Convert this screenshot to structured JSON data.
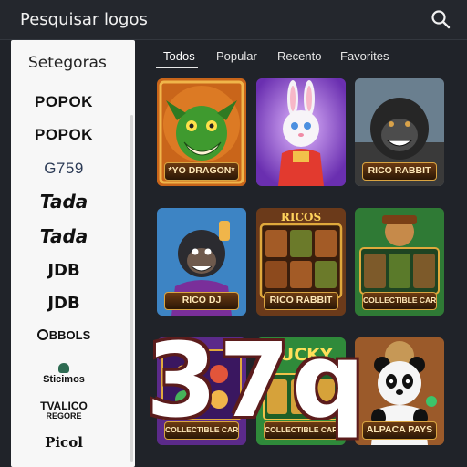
{
  "header": {
    "title": "Pesquisar logos",
    "search_icon": "search-icon"
  },
  "sidebar": {
    "heading": "Setegoras",
    "brands": [
      {
        "label": "POPOK",
        "sub": ""
      },
      {
        "label": "POPOK",
        "sub": ""
      },
      {
        "label": "G759",
        "sub": ""
      },
      {
        "label": "Tada",
        "sub": ""
      },
      {
        "label": "Tada",
        "sub": ""
      },
      {
        "label": "JDB",
        "sub": ""
      },
      {
        "label": "JDB",
        "sub": ""
      },
      {
        "label": "BBOLS",
        "sub": ""
      },
      {
        "label": "Sticimos",
        "sub": ""
      },
      {
        "label": "TVALICO",
        "sub": "REGORE"
      },
      {
        "label": "Picol",
        "sub": ""
      }
    ]
  },
  "tabs": [
    {
      "label": "Todos",
      "active": true
    },
    {
      "label": "Popular",
      "active": false
    },
    {
      "label": "Recento",
      "active": false
    },
    {
      "label": "Favorites",
      "active": false
    }
  ],
  "games": [
    {
      "title": "*YO DRAGON*",
      "art": "dragon"
    },
    {
      "title": "",
      "art": "rabbit"
    },
    {
      "title": "RICO RABBIT",
      "art": "gorilla"
    },
    {
      "title": "RICO DJ",
      "art": "monkey-dj"
    },
    {
      "title": "RICO RABBIT",
      "art": "ricos-slot"
    },
    {
      "title": "COLLECTIBLE CARDS",
      "art": "pirate-slot"
    },
    {
      "title": "COLLECTIBLE CARDS",
      "art": "slot-purple"
    },
    {
      "title": "COLLECTIBLE CARDS",
      "art": "lucky-slot"
    },
    {
      "title": "ALPACA PAYS",
      "art": "panda"
    }
  ],
  "card_texts": {
    "ricos": "RICOS",
    "lucky": "LUCKY"
  },
  "overlay": {
    "watermark": "37q"
  },
  "colors": {
    "background": "#202329",
    "sidebar": "#f7f7f7",
    "plate_border": "#d9a441"
  }
}
